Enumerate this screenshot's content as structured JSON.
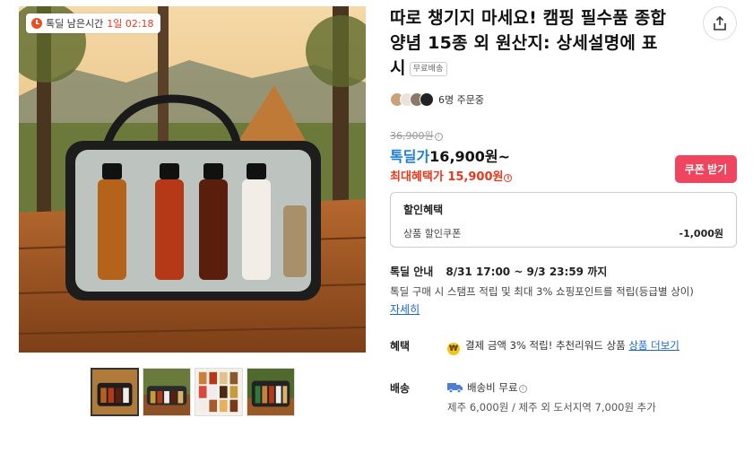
{
  "deal_timer": {
    "label": "톡딜 남은시간",
    "value": "1일 02:18"
  },
  "product": {
    "title": "따로 챙기지 마세요! 캠핑 필수품 종합 양념 15종 외 원산지: 상세설명에 표시",
    "free_shipping_badge": "무료배송"
  },
  "buyers": {
    "text": "6명 주문중"
  },
  "price": {
    "original": "36,900원",
    "deal_label": "톡딜가",
    "deal_value": "16,900원~",
    "max_benefit_label": "최대혜택가",
    "max_benefit_value": "15,900원"
  },
  "coupon_button": "쿠폰 받기",
  "discount": {
    "title": "할인혜택",
    "row_label": "상품 할인쿠폰",
    "row_amount": "-1,000원"
  },
  "deal_guide": {
    "label": "톡딜 안내",
    "period": "8/31 17:00 ~ 9/3 23:59 까지",
    "description": "톡딜 구매 시 스탬프 적립 및 최대 3% 쇼핑포인트를 적립(등급별 상이)",
    "detail_link": "자세히"
  },
  "benefit": {
    "label": "혜택",
    "text": "결제 금액 3% 적립! 추천리워드 상품",
    "link": "상품 더보기"
  },
  "shipping": {
    "label": "배송",
    "fee": "배송비 무료",
    "extra": "제주 6,000원 / 제주 외 도서지역 7,000원 추가"
  },
  "icons": {
    "timer": "clock-icon",
    "share": "share-icon",
    "info": "info-icon",
    "benefit": "won-coin-icon",
    "shipping": "truck-icon"
  },
  "colors": {
    "accent_red": "#e8391f",
    "coupon_pink": "#f0455e",
    "deal_blue": "#1c7ed6",
    "link_blue": "#1c66c9"
  }
}
